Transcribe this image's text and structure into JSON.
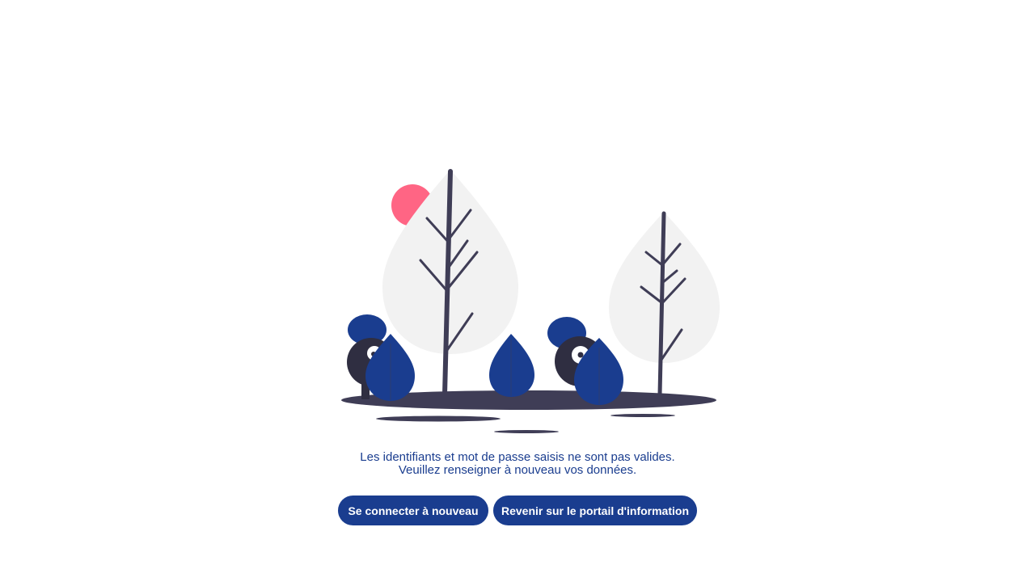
{
  "error": {
    "line1": "Les identifiants et mot de passe saisis ne sont pas valides.",
    "line2": "Veuillez renseigner à nouveau vos données."
  },
  "actions": {
    "reconnect_label": "Se connecter à nouveau",
    "portal_label": "Revenir sur le portail d'information"
  },
  "colors": {
    "accent": "#1a3d8f",
    "sun": "#ff6584",
    "tree_canopy": "#f2f2f2",
    "trunk": "#3f3d56",
    "figure_dark": "#2f2e41"
  }
}
